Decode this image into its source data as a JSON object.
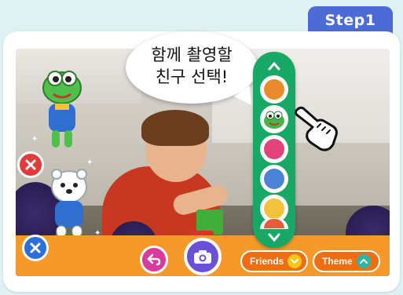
{
  "step_tab": {
    "label": "Step1"
  },
  "speech_bubble": {
    "line1": "함께 촬영할",
    "line2": "친구 선택!"
  },
  "character_panel": {
    "scroll_up_icon": "chevron-up-icon",
    "scroll_down_icon": "chevron-down-icon",
    "slots": [
      {
        "icon": "character-red-icon",
        "color": "#e98a2b"
      },
      {
        "icon": "frog-character-icon",
        "color": "#48b54a"
      },
      {
        "icon": "bird-character-icon",
        "color": "#e2447a"
      },
      {
        "icon": "penguin-character-icon",
        "color": "#4a83d8"
      },
      {
        "icon": "group-characters-icon",
        "color": "#f2c23a"
      },
      {
        "icon": "character-partial-icon",
        "color": "#e85a3a"
      }
    ]
  },
  "bottom_bar": {
    "friends_label": "Friends",
    "friends_color": "#f5c518",
    "theme_label": "Theme",
    "theme_color": "#2bb6a6"
  },
  "colors": {
    "step_tab": "#4c6bd6",
    "panel": "#17a865",
    "toolbar": "#f59a2a",
    "camera_button": "#6a4fd8",
    "back_button": "#d93a9b",
    "close_red": "#e23b3b",
    "close_blue": "#2d6fd9"
  }
}
